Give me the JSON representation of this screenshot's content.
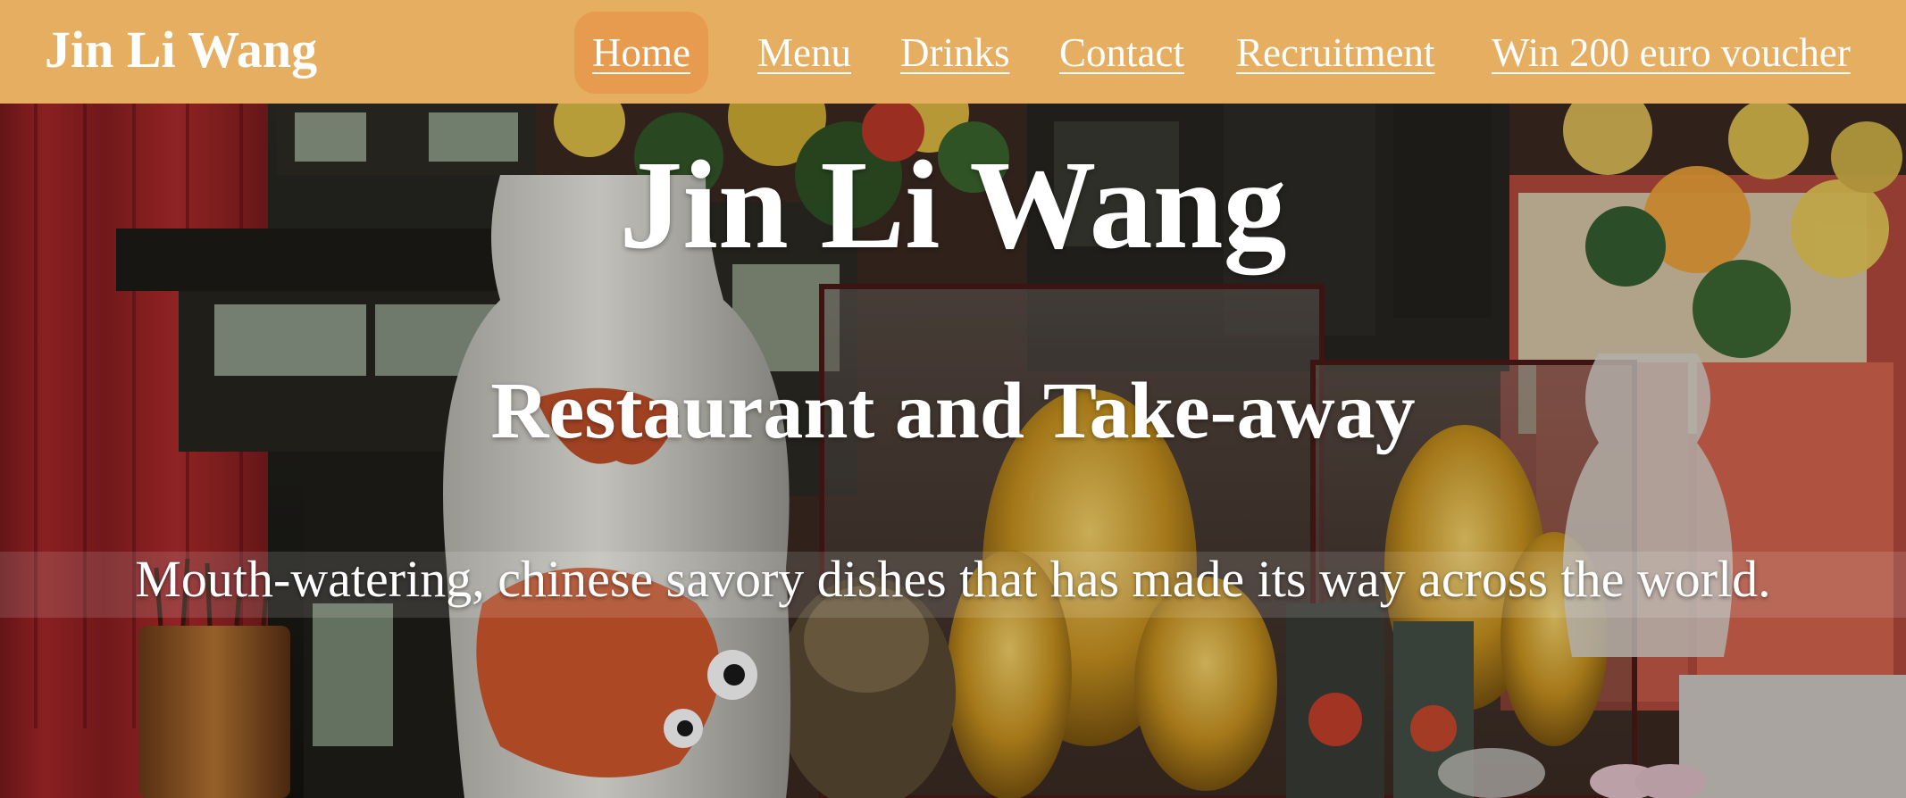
{
  "nav": {
    "brand": "Jin Li Wang",
    "links": [
      {
        "label": "Home",
        "active": true
      },
      {
        "label": "Menu",
        "active": false
      },
      {
        "label": "Drinks",
        "active": false
      },
      {
        "label": "Contact",
        "active": false
      },
      {
        "label": "Recruitment",
        "active": false
      },
      {
        "label": "Win 200 euro voucher",
        "active": false
      }
    ]
  },
  "hero": {
    "title": "Jin Li Wang",
    "subtitle": "Restaurant and Take-away",
    "tagline": "Mouth-watering, chinese savory dishes that has made its way across the world.",
    "background": "chinese-temple-altar-photo"
  },
  "colors": {
    "navbar": "#e6ae60",
    "nav_active": "#e69b4e",
    "text": "#ffffff"
  }
}
